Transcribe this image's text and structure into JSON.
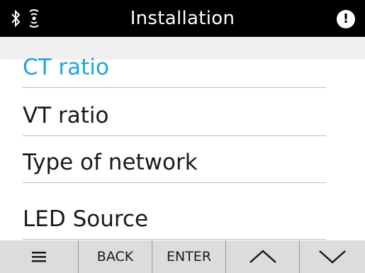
{
  "header": {
    "title": "Installation",
    "left_icons": [
      "bluetooth-icon",
      "signal-icon"
    ],
    "right_icon": "alert-icon",
    "alert_symbol": "!"
  },
  "menu": {
    "items": [
      {
        "label": "CT ratio",
        "selected": true
      },
      {
        "label": "VT ratio",
        "selected": false
      },
      {
        "label": "Type of network",
        "selected": false
      },
      {
        "label": "LED Source",
        "selected": false
      }
    ]
  },
  "footer": {
    "menu_icon": "hamburger-icon",
    "back_label": "BACK",
    "enter_label": "ENTER",
    "up_icon": "chevron-up-icon",
    "down_icon": "chevron-down-icon"
  },
  "colors": {
    "header_bg": "#000000",
    "selected_text": "#1aa6e0",
    "footer_bg": "#dcdcdc"
  }
}
